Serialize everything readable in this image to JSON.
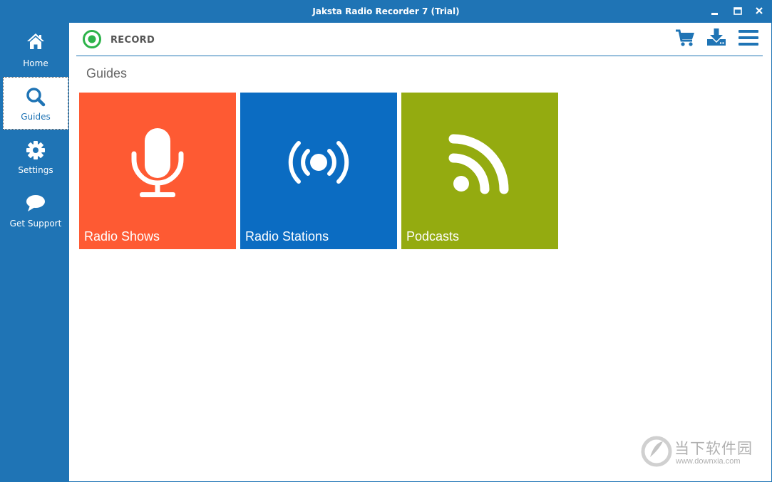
{
  "window": {
    "title": "Jaksta Radio Recorder 7 (Trial)"
  },
  "titlebar_buttons": [
    {
      "name": "minimize",
      "icon": "minimize-icon"
    },
    {
      "name": "maximize",
      "icon": "maximize-icon"
    },
    {
      "name": "close",
      "icon": "close-icon"
    }
  ],
  "sidebar": {
    "items": [
      {
        "label": "Home",
        "icon": "home-icon",
        "active": false
      },
      {
        "label": "Guides",
        "icon": "search-icon",
        "active": true
      },
      {
        "label": "Settings",
        "icon": "gear-icon",
        "active": false
      },
      {
        "label": "Get Support",
        "icon": "chat-bubble-icon",
        "active": false
      }
    ]
  },
  "header": {
    "record_label": "RECORD",
    "record_icon": "record-icon",
    "icons": [
      "cart-icon",
      "download-icon",
      "menu-icon"
    ]
  },
  "page": {
    "title": "Guides"
  },
  "tiles": [
    {
      "label": "Radio Shows",
      "icon": "microphone-icon",
      "color": "#fe5a33"
    },
    {
      "label": "Radio Stations",
      "icon": "broadcast-icon",
      "color": "#0b6cc2"
    },
    {
      "label": "Podcasts",
      "icon": "rss-icon",
      "color": "#94ab10"
    }
  ],
  "watermark": {
    "text": "当下软件园",
    "url": "www.downxia.com"
  },
  "colors": {
    "accent": "#1f74b5",
    "record_green": "#2db34a"
  }
}
